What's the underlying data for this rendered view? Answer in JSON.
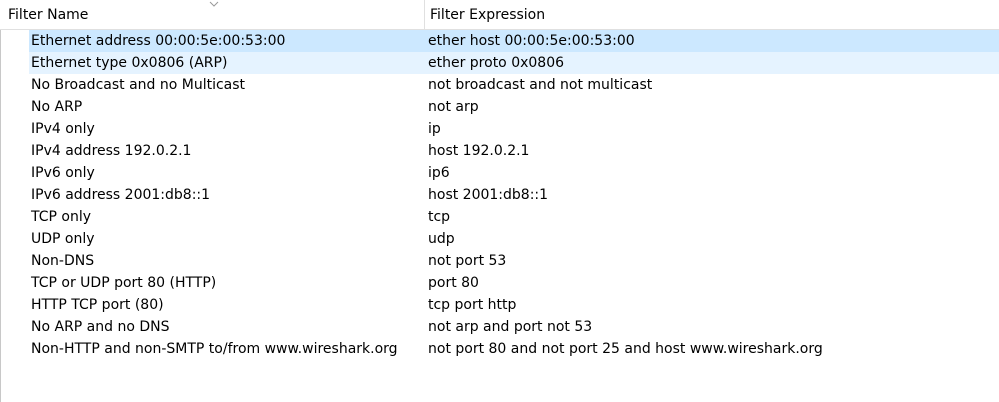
{
  "headers": {
    "filter_name": "Filter Name",
    "filter_expression": "Filter Expression"
  },
  "rows": [
    {
      "name": "Ethernet address 00:00:5e:00:53:00",
      "expr": "ether host 00:00:5e:00:53:00",
      "state": "selected"
    },
    {
      "name": "Ethernet type 0x0806 (ARP)",
      "expr": "ether proto 0x0806",
      "state": "hover"
    },
    {
      "name": "No Broadcast and no Multicast",
      "expr": "not broadcast and not multicast",
      "state": "normal"
    },
    {
      "name": "No ARP",
      "expr": "not arp",
      "state": "normal"
    },
    {
      "name": "IPv4 only",
      "expr": "ip",
      "state": "normal"
    },
    {
      "name": "IPv4 address 192.0.2.1",
      "expr": "host 192.0.2.1",
      "state": "normal"
    },
    {
      "name": "IPv6 only",
      "expr": "ip6",
      "state": "normal"
    },
    {
      "name": "IPv6 address 2001:db8::1",
      "expr": "host 2001:db8::1",
      "state": "normal"
    },
    {
      "name": "TCP only",
      "expr": "tcp",
      "state": "normal"
    },
    {
      "name": "UDP only",
      "expr": "udp",
      "state": "normal"
    },
    {
      "name": "Non-DNS",
      "expr": "not port 53",
      "state": "normal"
    },
    {
      "name": "TCP or UDP port 80 (HTTP)",
      "expr": "port 80",
      "state": "normal"
    },
    {
      "name": "HTTP TCP port (80)",
      "expr": "tcp port http",
      "state": "normal"
    },
    {
      "name": "No ARP and no DNS",
      "expr": "not arp and port not 53",
      "state": "normal"
    },
    {
      "name": "Non-HTTP and non-SMTP to/from www.wireshark.org",
      "expr": "not port 80 and not port 25 and host www.wireshark.org",
      "state": "normal"
    }
  ],
  "colors": {
    "selected_bg": "#cce8ff",
    "hover_bg": "#e5f3ff",
    "text": "#000000"
  },
  "icons": {
    "sort_indicator": "chevron-down-icon"
  }
}
